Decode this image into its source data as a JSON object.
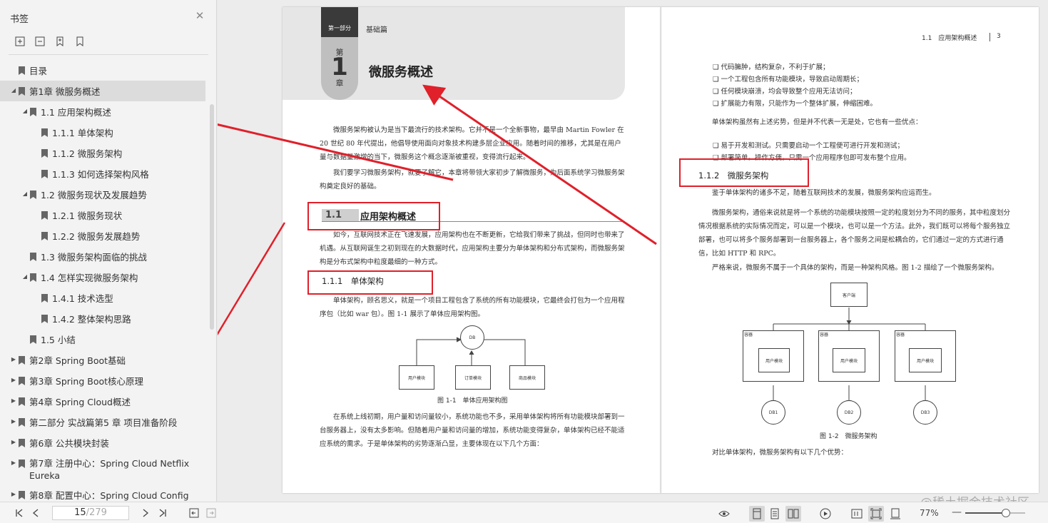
{
  "sidebar": {
    "title": "书签",
    "items": [
      {
        "label": "目录"
      },
      {
        "label": "第1章 微服务概述"
      },
      {
        "label": "1.1 应用架构概述"
      },
      {
        "label": "1.1.1 单体架构"
      },
      {
        "label": "1.1.2 微服务架构"
      },
      {
        "label": "1.1.3 如何选择架构风格"
      },
      {
        "label": "1.2 微服务现状及发展趋势"
      },
      {
        "label": "1.2.1 微服务现状"
      },
      {
        "label": "1.2.2 微服务发展趋势"
      },
      {
        "label": "1.3 微服务架构面临的挑战"
      },
      {
        "label": "1.4 怎样实现微服务架构"
      },
      {
        "label": "1.4.1 技术选型"
      },
      {
        "label": "1.4.2 整体架构思路"
      },
      {
        "label": "1.5 小结"
      },
      {
        "label": "第2章 Spring Boot基础"
      },
      {
        "label": "第3章 Spring Boot核心原理"
      },
      {
        "label": "第4章 Spring Cloud概述"
      },
      {
        "label": "第二部分 实战篇第5 章 项目准备阶段"
      },
      {
        "label": "第6章 公共模块封装"
      },
      {
        "label": "第7章 注册中心：Spring Cloud Netflix Eureka"
      },
      {
        "label": "第8章 配置中心：Spring Cloud Config"
      }
    ]
  },
  "left_page": {
    "part_tag": "第一部分",
    "part_name": "基础篇",
    "chap_di": "第",
    "chap_num": "1",
    "chap_zhang": "章",
    "chap_title": "微服务概述",
    "p1": "微服务架构被认为是当下最流行的技术架构。它并不是一个全新事物，最早由 Martin Fowler 在20 世纪 80 年代提出，他倡导使用面向对象技术构建多层企业应用。随着时间的推移，尤其是在用户量与数据量激增的当下，微服务这个概念逐渐被重视，变得流行起来。",
    "p2": "我们要学习微服务架构，就要了解它，本章将带领大家初步了解微服务，为后面系统学习微服务架构奠定良好的基础。",
    "h1_num": "1.1",
    "h1_title": "应用架构概述",
    "p3": "如今，互联网技术正在飞速发展，应用架构也在不断更新，它给我们带来了挑战，但同时也带来了机遇。从互联网诞生之初到现在的大数据时代，应用架构主要分为单体架构和分布式架构，而微服务架构是分布式架构中粒度最细的一种方式。",
    "h2": "1.1.1　单体架构",
    "p4": "单体架构，顾名思义，就是一个项目工程包含了系统的所有功能模块，它最终会打包为一个应用程序包（比如 war 包）。图 1-1 展示了单体应用架构图。",
    "fig1": {
      "db": "DB",
      "m1": "用户模块",
      "m2": "订单模块",
      "m3": "商品模块",
      "caption": "图 1-1　单体应用架构图"
    },
    "p5": "在系统上线初期，用户量和访问量较小，系统功能也不多，采用单体架构将所有功能模块部署到一台服务器上，没有太多影响。但随着用户量和访问量的增加，系统功能变得复杂，单体架构已经不能适应系统的需求。于是单体架构的劣势逐渐凸显，主要体现在以下几个方面："
  },
  "right_page": {
    "header": "1.1　应用架构概述",
    "page_no": "3",
    "bullets1": [
      "代码臃肿，结构复杂，不利于扩展；",
      "一个工程包含所有功能模块，导致启动周期长；",
      "任何模块崩溃，均会导致整个应用无法访问；",
      "扩展能力有限，只能作为一个整体扩展，伸缩困难。"
    ],
    "p1": "单体架构虽然有上述劣势，但是并不代表一无是处，它也有一些优点：",
    "bullets2": [
      "易于开发和测试。只需要启动一个工程便可进行开发和测试；",
      "部署简单。操作方便，只需一个应用程序包即可发布整个应用。"
    ],
    "h2": "1.1.2　微服务架构",
    "p2": "鉴于单体架构的诸多不足，随着互联网技术的发展，微服务架构应运而生。",
    "p3": "微服务架构，通俗来说就是将一个系统的功能模块按照一定的粒度划分为不同的服务，其中粒度划分情况根据系统的实际情况而定，可以是一个模块，也可以是一个方法。此外，我们既可以将每个服务独立部署，也可以将多个服务部署到一台服务器上，各个服务之间是松耦合的，它们通过一定的方式进行通信，比如 HTTP 和 RPC。",
    "p4": "严格来说，微服务不属于一个具体的架构，而是一种架构风格。图 1-2 描绘了一个微服务架构。",
    "fig2": {
      "client": "客户端",
      "container": "容器",
      "module": "用户模块",
      "db1": "DB1",
      "db2": "DB2",
      "db3": "DB3",
      "caption": "图 1-2　微服务架构"
    },
    "p5": "对比单体架构，微服务架构有以下几个优势："
  },
  "bottombar": {
    "page_current": "15",
    "page_total": "/279",
    "zoom": "77%",
    "zoom_fraction": 0.68
  },
  "watermark": "@稀土掘金技术社区",
  "colors": {
    "annotation_red": "#e0202a"
  }
}
